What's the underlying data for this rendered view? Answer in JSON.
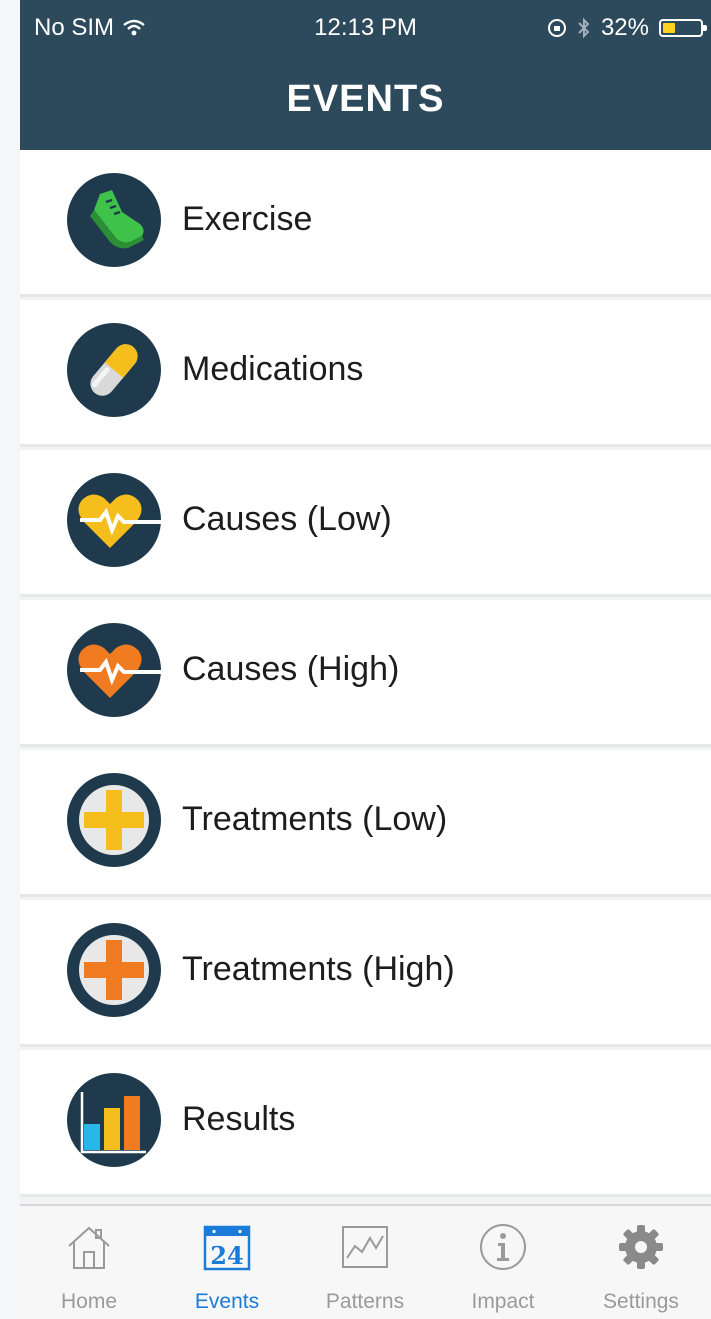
{
  "status_bar": {
    "carrier": "No SIM",
    "time": "12:13 PM",
    "battery": "32%"
  },
  "header": {
    "title": "EVENTS"
  },
  "list": {
    "items": [
      {
        "label": "Exercise",
        "icon": "shoe-icon"
      },
      {
        "label": "Medications",
        "icon": "pill-icon"
      },
      {
        "label": "Causes (Low)",
        "icon": "heart-pulse-icon"
      },
      {
        "label": "Causes (High)",
        "icon": "heart-pulse-icon"
      },
      {
        "label": "Treatments (Low)",
        "icon": "plus-cross-icon"
      },
      {
        "label": "Treatments (High)",
        "icon": "plus-cross-icon"
      },
      {
        "label": "Results",
        "icon": "bar-chart-icon"
      }
    ]
  },
  "tabbar": {
    "tabs": [
      {
        "label": "Home",
        "icon": "home-icon"
      },
      {
        "label": "Events",
        "icon": "calendar-icon",
        "badge": "24",
        "active": true
      },
      {
        "label": "Patterns",
        "icon": "line-chart-icon"
      },
      {
        "label": "Impact",
        "icon": "info-icon"
      },
      {
        "label": "Settings",
        "icon": "gear-icon"
      }
    ]
  },
  "colors": {
    "header_bg": "#2d4a5c",
    "icon_circle": "#1f3a4c",
    "yellow": "#f5be1c",
    "orange": "#f07b21",
    "green": "#3ec24a",
    "active_tab": "#1a7bd8"
  }
}
